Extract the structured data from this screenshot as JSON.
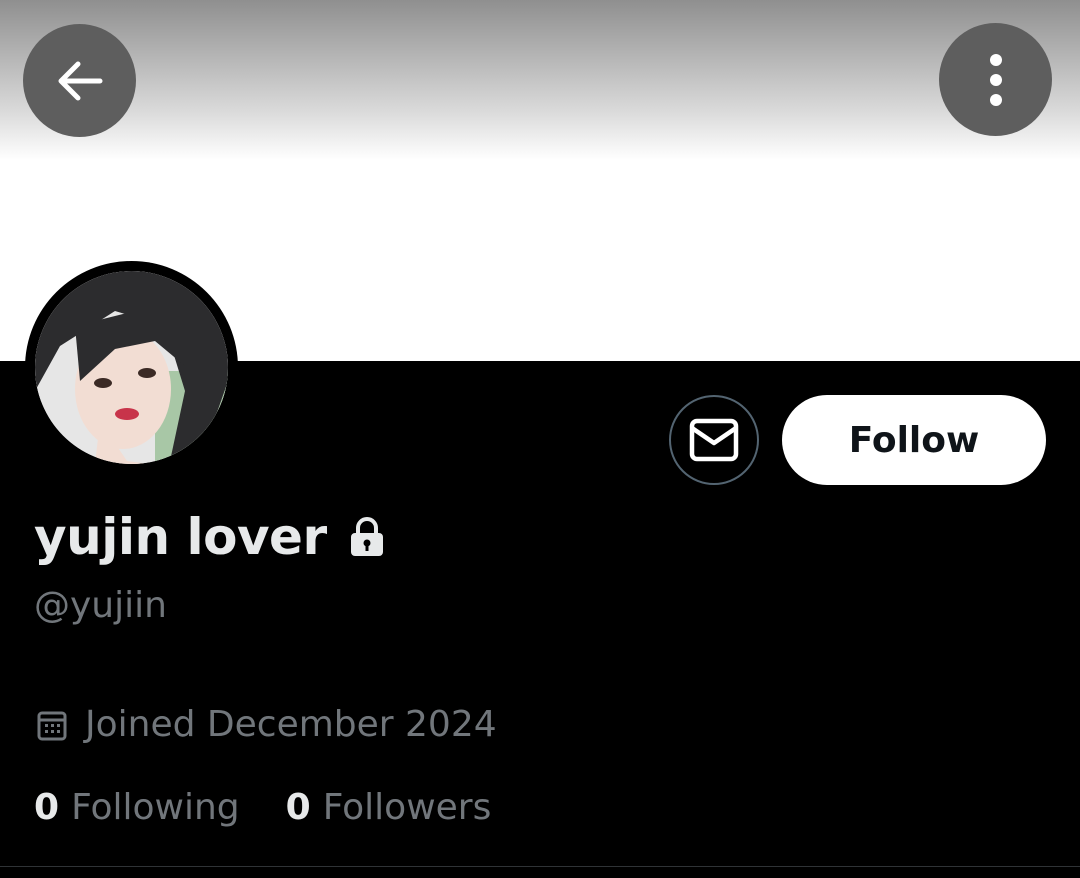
{
  "header": {
    "back_icon": "arrow-left-icon",
    "more_icon": "more-vertical-icon"
  },
  "profile": {
    "display_name": "yujin lover",
    "handle": "@yujiin",
    "protected_icon": "lock-icon",
    "joined": "Joined December 2024",
    "joined_icon": "calendar-icon"
  },
  "actions": {
    "message_icon": "mail-icon",
    "follow_label": "Follow"
  },
  "stats": {
    "following_count": "0",
    "following_label": "Following",
    "followers_count": "0",
    "followers_label": "Followers"
  },
  "colors": {
    "background": "#000000",
    "primary_text": "#e7e9ea",
    "secondary_text": "#71767b",
    "follow_button_bg": "#ffffff",
    "follow_button_text": "#0f1419",
    "icon_button_bg": "#5e5e5e",
    "outline": "#536471"
  }
}
